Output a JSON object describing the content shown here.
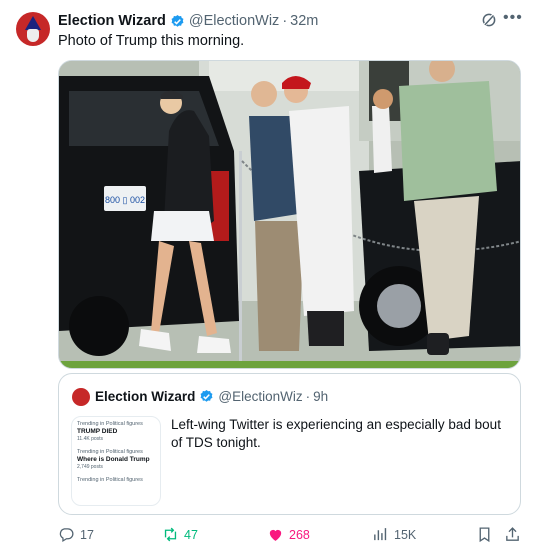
{
  "post": {
    "author_name": "Election Wizard",
    "handle": "@ElectionWiz",
    "separator": "·",
    "time": "32m",
    "text": "Photo of Trump this morning."
  },
  "photo": {
    "license_plate": "800 ▯ 002"
  },
  "quote": {
    "author_name": "Election Wizard",
    "handle": "@ElectionWiz",
    "separator": "·",
    "time": "9h",
    "text": "Left-wing Twitter is experiencing an especially bad bout of TDS tonight.",
    "thumbnail_trends": [
      {
        "category": "Trending in Political figures",
        "topic": "TRUMP DIED",
        "posts": "11.4K posts"
      },
      {
        "category": "Trending in Political figures",
        "topic": "Where is Donald Trump",
        "posts": "2,749 posts"
      },
      {
        "category": "Trending in Political figures",
        "topic": "",
        "posts": ""
      }
    ]
  },
  "actions": {
    "replies": "17",
    "reposts": "47",
    "likes": "268",
    "views": "15K"
  },
  "colors": {
    "verified": "#1d9bf0",
    "repost_active": "#00ba7c",
    "like_active": "#f91880",
    "secondary_text": "#536471"
  },
  "icons": {
    "verified": "verified-badge-icon",
    "grok": "grok-icon",
    "more": "more-icon",
    "reply": "reply-icon",
    "repost": "repost-icon",
    "like": "heart-icon",
    "views": "views-icon",
    "bookmark": "bookmark-icon",
    "share": "share-icon"
  }
}
